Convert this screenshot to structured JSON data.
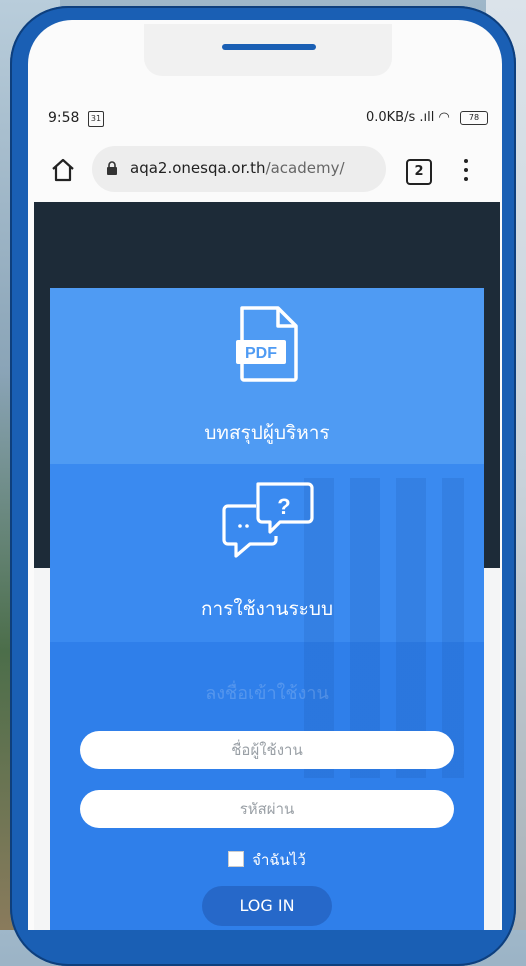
{
  "status_bar": {
    "time": "9:58",
    "calendar_day": "31",
    "network_speed": "0.0KB/s",
    "battery": "78"
  },
  "browser": {
    "url_domain": "aqa2.onesqa.or.th",
    "url_path": "/academy/",
    "tab_count": "2"
  },
  "menu": {
    "pdf_label": "บทสรุปผู้บริหาร",
    "pdf_icon_text": "PDF",
    "help_label": "การใช้งานระบบ",
    "help_icon_text": "?"
  },
  "login": {
    "heading": "ลงชื่อเข้าใช้งาน",
    "username_placeholder": "ชื่อผู้ใช้งาน",
    "password_placeholder": "รหัสผ่าน",
    "remember_label": "จำฉันไว้",
    "login_button": "LOG IN"
  },
  "colors": {
    "phone_frame": "#1a5fb4",
    "panel_blue": "#3d8ff0",
    "login_button": "#2668c9"
  }
}
